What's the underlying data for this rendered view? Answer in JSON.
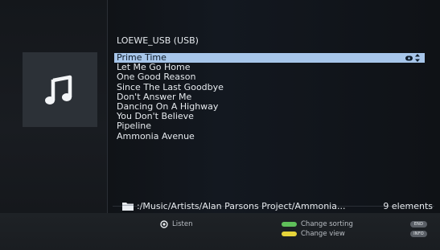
{
  "source": {
    "title": "LOEWE_USB (USB)"
  },
  "tracks": [
    {
      "title": "Prime Time"
    },
    {
      "title": "Let Me Go Home"
    },
    {
      "title": "One Good Reason"
    },
    {
      "title": "Since The Last Goodbye"
    },
    {
      "title": "Don't Answer Me"
    },
    {
      "title": "Dancing On A Highway"
    },
    {
      "title": "You Don't Believe"
    },
    {
      "title": "Pipeline"
    },
    {
      "title": "Ammonia Avenue"
    }
  ],
  "selected_index": 0,
  "footer": {
    "path": ":/Music/Artists/Alan Parsons Project/Ammonia...",
    "count": "9 elements"
  },
  "hints": {
    "listen": "Listen",
    "change_sorting": "Change sorting",
    "change_view": "Change view",
    "end_key": "END",
    "info_key": "INFO"
  },
  "colors": {
    "selected_row": "#a7c6ea",
    "green_button": "#5fbf5a",
    "yellow_button": "#e6d43a"
  },
  "icons": {
    "album_art": "music-note-icon",
    "folder": "folder-icon",
    "ok": "ok-button-icon"
  }
}
